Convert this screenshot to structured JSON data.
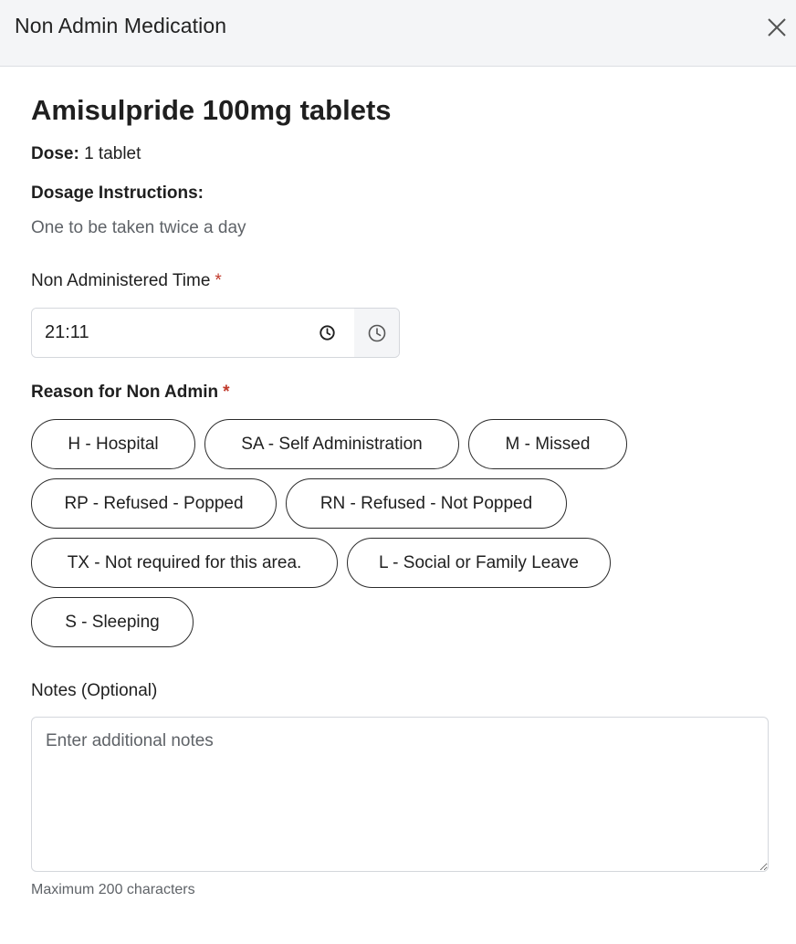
{
  "modal": {
    "title": "Non Admin Medication"
  },
  "medication": {
    "name": "Amisulpride 100mg tablets",
    "dose_label": "Dose:",
    "dose_value": "1 tablet",
    "instructions_label": "Dosage Instructions:",
    "instructions_text": "One to be taken twice a day"
  },
  "time_field": {
    "label": "Non Administered Time",
    "required_marker": "*",
    "value": "21:11"
  },
  "reason": {
    "label": "Reason for Non Admin",
    "required_marker": "*",
    "options": [
      "H - Hospital",
      "SA - Self Administration",
      "M - Missed",
      "RP - Refused - Popped",
      "RN - Refused - Not Popped",
      "TX - Not required for this area.",
      "L - Social or Family Leave",
      "S - Sleeping"
    ]
  },
  "notes": {
    "label": "Notes (Optional)",
    "placeholder": "Enter additional notes",
    "value": "",
    "hint": "Maximum 200 characters"
  },
  "icons": {
    "close": "close-icon",
    "clock": "clock-icon"
  }
}
